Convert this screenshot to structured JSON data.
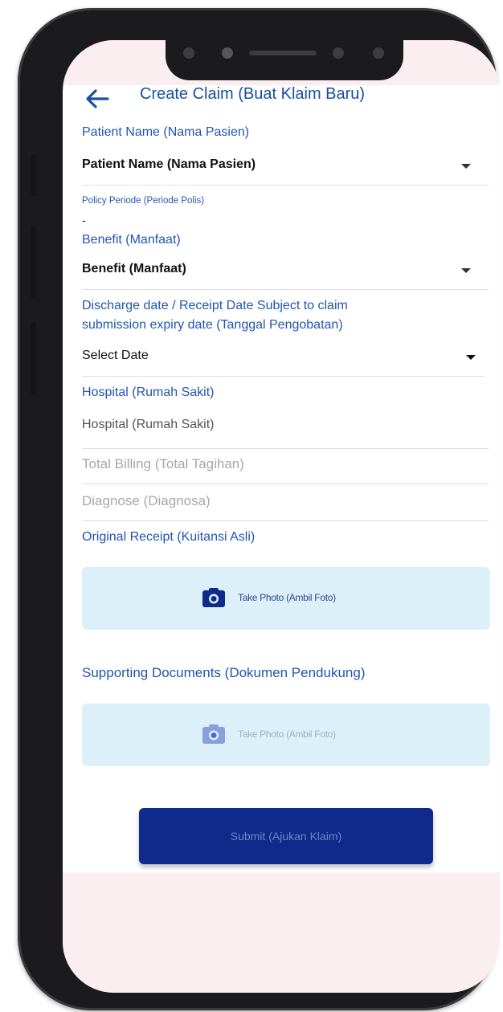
{
  "header": {
    "title": "Create Claim (Buat Klaim Baru)"
  },
  "form": {
    "patient_label": "Patient Name (Nama Pasien)",
    "patient_value": "Patient Name (Nama Pasien)",
    "policy_label": "Policy Periode (Periode Polis)",
    "policy_value": "-",
    "benefit_label": "Benefit (Manfaat)",
    "benefit_value": "Benefit (Manfaat)",
    "discharge_label_line1": "Discharge date / Receipt Date Subject to claim",
    "discharge_label_line2": "submission expiry date (Tanggal Pengobatan)",
    "discharge_value": "Select Date",
    "hospital_label": "Hospital (Rumah Sakit)",
    "hospital_value": "Hospital (Rumah Sakit)",
    "billing_placeholder": "Total Billing (Total Tagihan)",
    "diagnose_placeholder": "Diagnose (Diagnosa)",
    "original_receipt_label": "Original Receipt (Kuitansi Asli)",
    "supporting_docs_label": "Supporting Documents (Dokumen Pendukung)",
    "take_photo_label": "Take Photo (Ambil Foto)",
    "take_photo_label_2": "Take Photo (Ambil Foto)"
  },
  "actions": {
    "submit_label": "Submit (Ajukan Klaim)"
  },
  "colors": {
    "accent_blue": "#2255b0",
    "submit_bg": "#0f2a8a",
    "upload_bg": "#dcf0fa"
  },
  "icons": [
    "back-arrow-icon",
    "caret-down-icon",
    "camera-icon"
  ]
}
